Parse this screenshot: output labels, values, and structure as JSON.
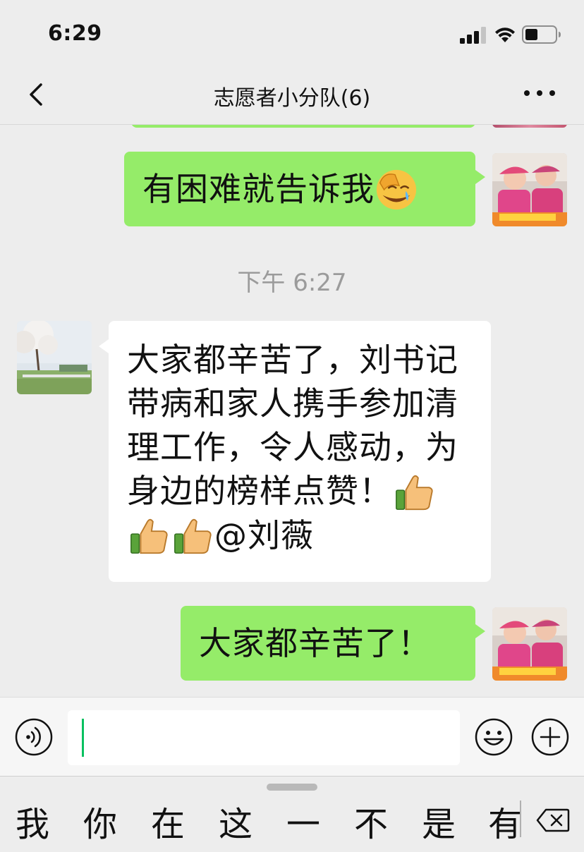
{
  "status_bar": {
    "time": "6:29"
  },
  "nav": {
    "title": "志愿者小分队(6)"
  },
  "messages": [
    {
      "side": "sent",
      "text": "有困难就告诉我",
      "emoji": "face-palm-laughing-icon"
    },
    {
      "side": "timestamp",
      "text": "下午 6:27"
    },
    {
      "side": "received",
      "text": "大家都辛苦了，刘书记带病和家人携手参加清理工作，令人感动，为身边的榜样点赞！",
      "emojis": [
        "thumbs-up-icon",
        "thumbs-up-icon",
        "thumbs-up-icon"
      ],
      "mention": "@刘薇"
    },
    {
      "side": "sent",
      "text": "大家都辛苦了！"
    }
  ],
  "input": {
    "value": ""
  },
  "keyboard": {
    "candidates": [
      "我",
      "你",
      "在",
      "这",
      "一",
      "不",
      "是",
      "有"
    ]
  },
  "colors": {
    "sent_bubble": "#95ec69",
    "received_bubble": "#ffffff",
    "background": "#ededed",
    "cursor": "#07c160"
  }
}
